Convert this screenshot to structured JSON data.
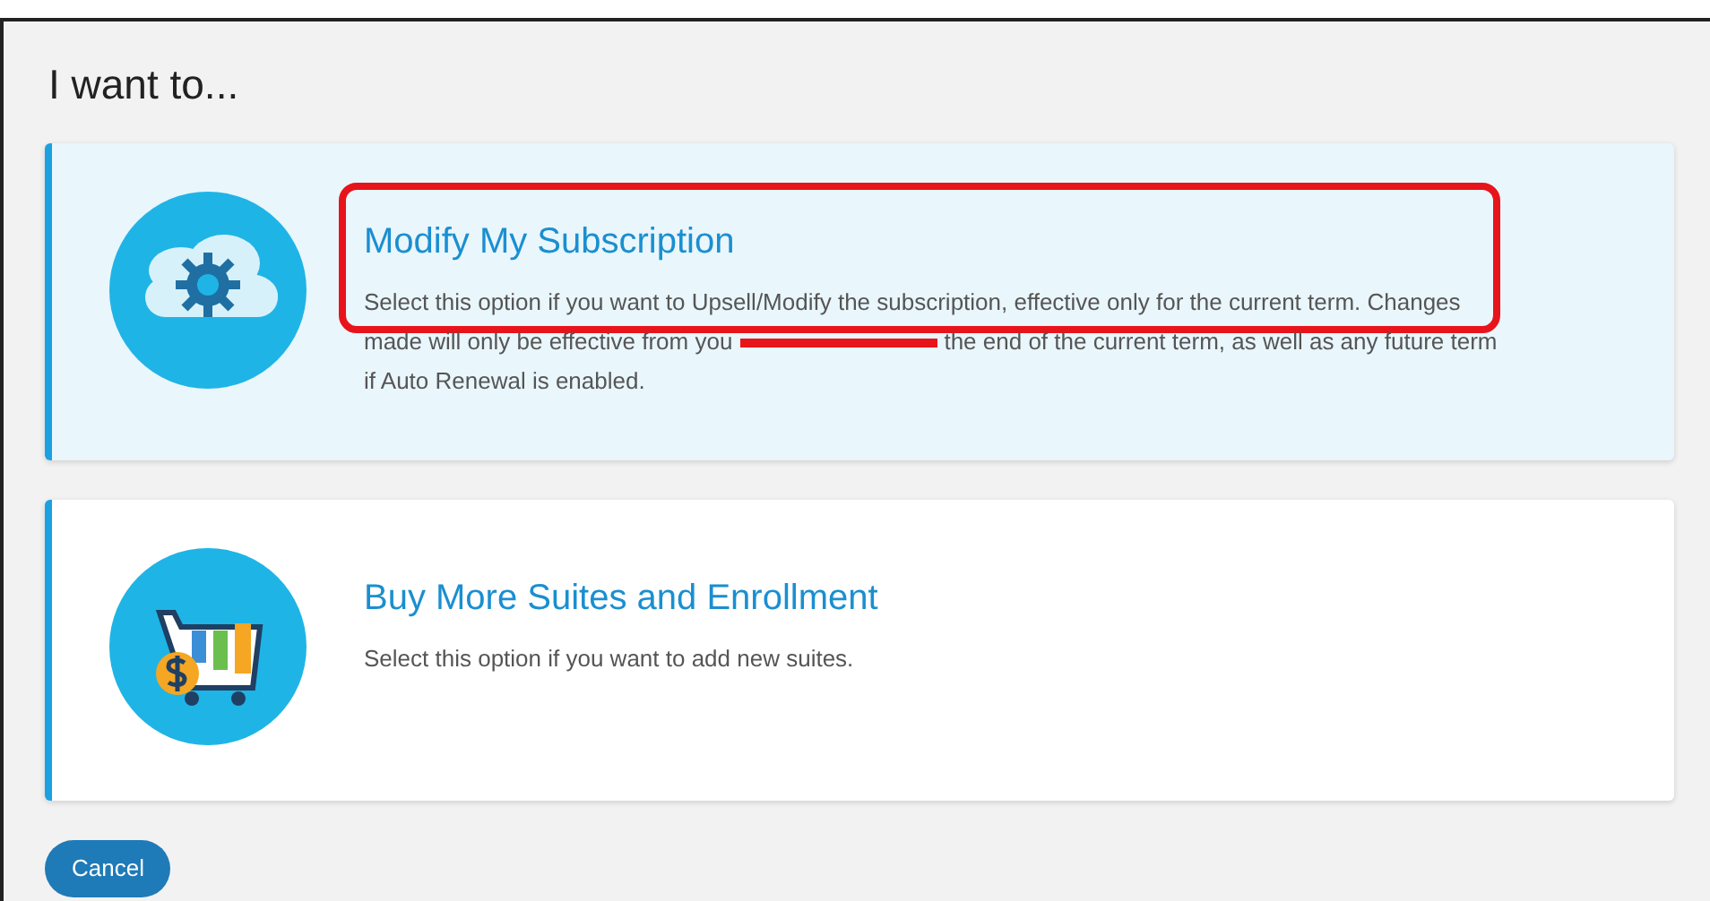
{
  "heading": "I want to...",
  "options": [
    {
      "kind": "cloud",
      "title": "Modify My Subscription",
      "selected": true,
      "annotated": true,
      "redacted": true,
      "description": [
        "Select this option if you want to Upsell/Modify the subscription, effective only for the current term. Changes made will only be effective from you",
        "the end of the current term, as well as any future term if Auto Renewal is enabled."
      ]
    },
    {
      "kind": "cart",
      "title": "Buy More Suites and Enrollment",
      "selected": false,
      "annotated": false,
      "redacted": false,
      "description": [
        "Select this option if you want to add new suites."
      ]
    }
  ],
  "buttons": [
    {
      "label": "Cancel"
    }
  ]
}
